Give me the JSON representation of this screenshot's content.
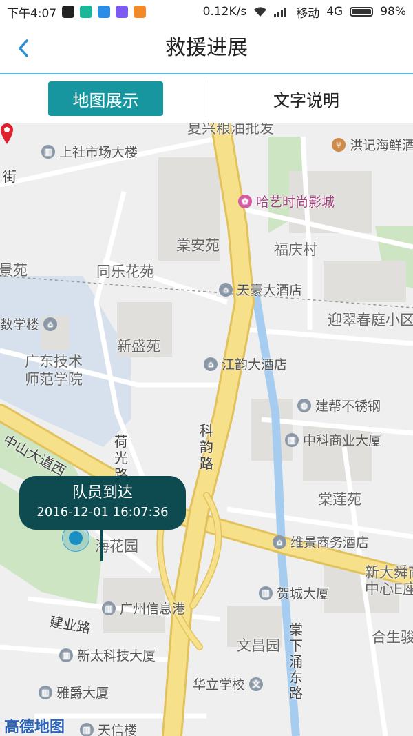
{
  "status_bar": {
    "time": "下午4:07",
    "network_speed": "0.12K/s",
    "carrier": "移动",
    "network_type": "4G",
    "battery": "98%",
    "battery_level": 0.98
  },
  "header": {
    "back_icon": "chevron-left-icon",
    "title": "救援进展"
  },
  "tabs": {
    "map_tab": "地图展示",
    "text_tab": "文字说明"
  },
  "map": {
    "areas": [
      "上社市场大楼",
      "棠安苑",
      "同乐花苑",
      "新盛苑",
      "广东技术",
      "师范学院",
      "景苑",
      "数学楼",
      "福庆村",
      "迎翠春庭小区",
      "棠莲苑",
      "文昌园",
      "新大舜商",
      "中心E座",
      "合生骏",
      "夏兴粮油批发"
    ],
    "pois": [
      "洪记海鲜酒",
      "哈艺时尚影城",
      "天豪大酒店",
      "江韵大酒店",
      "建帮不锈钢",
      "中科商业大厦",
      "维景商务酒店",
      "贺城大厦",
      "广州信息港",
      "新太科技大厦",
      "雅爵大厦",
      "华立学校",
      "天信楼",
      "海花园"
    ],
    "roads": [
      "中山大道西",
      "荷光路",
      "科韵路",
      "建业路",
      "棠下涌东路",
      "街"
    ],
    "logo": "高德地图",
    "colors": {
      "road_major": "#f7e08a",
      "road_major_edge": "#e2c25c",
      "water": "#a6cdef",
      "green": "#cde5c3",
      "campus": "#d6e1ed",
      "building": "#e1dfdb"
    }
  },
  "callout": {
    "title": "队员到达",
    "time": "2016-12-01 16:07:36"
  }
}
